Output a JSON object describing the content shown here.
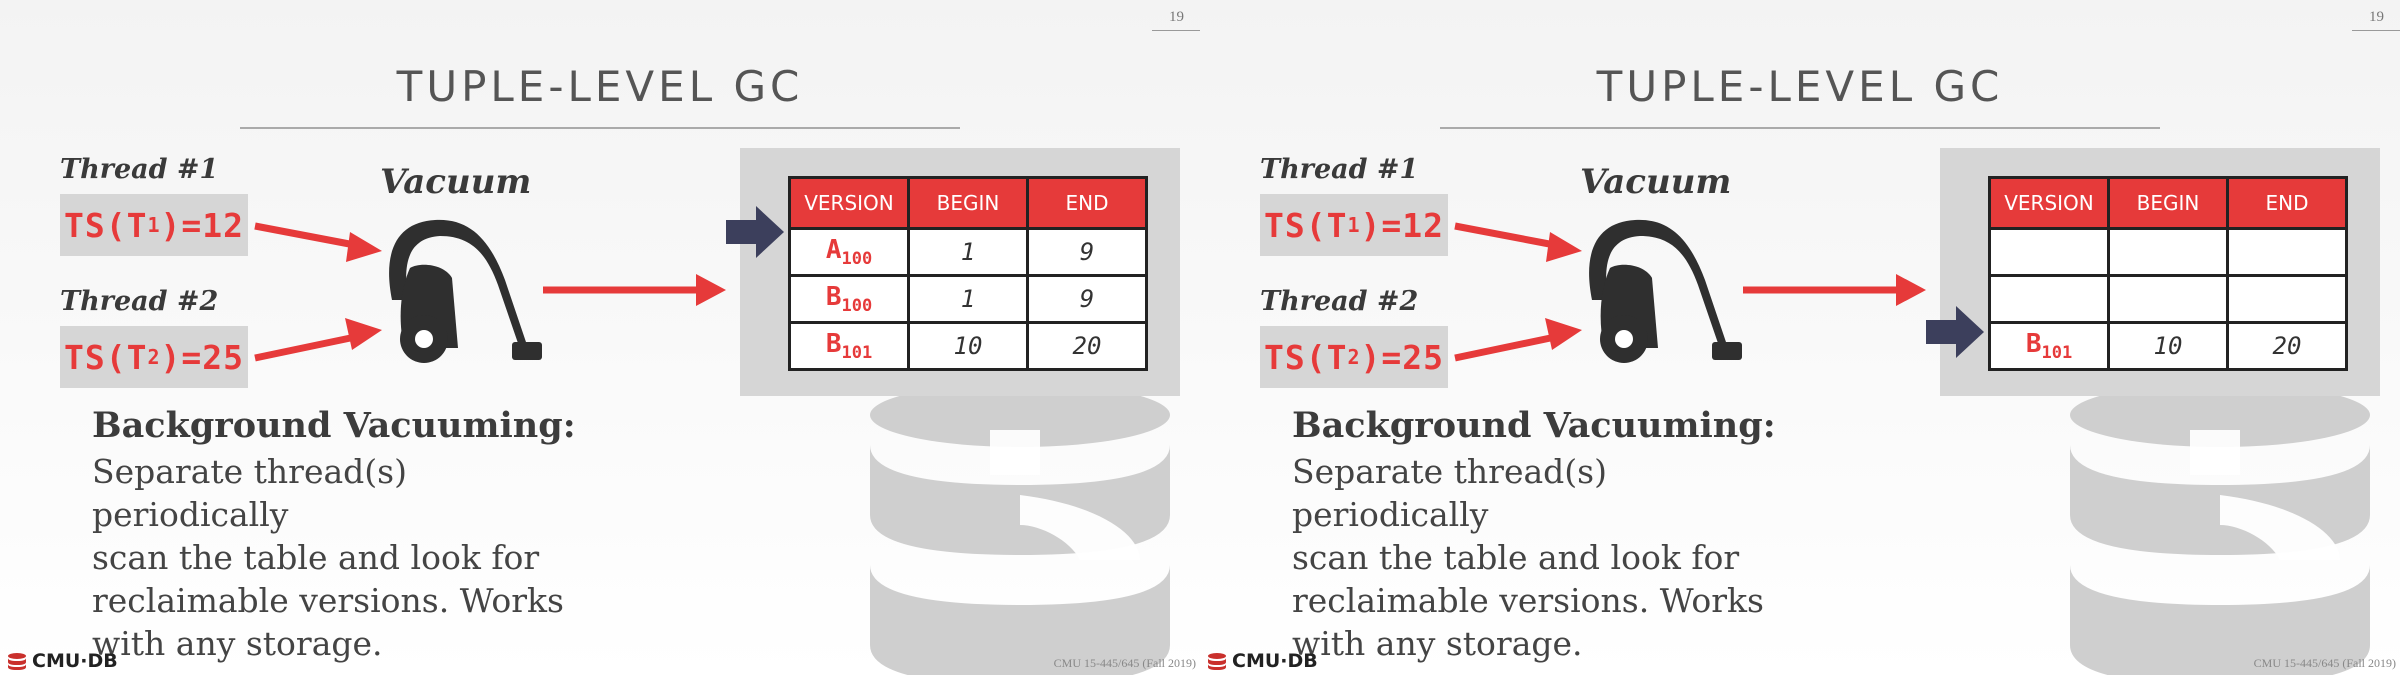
{
  "slides": [
    {
      "slide_number": "19",
      "title": "TUPLE-LEVEL GC",
      "thread1_label": "Thread #1",
      "thread2_label": "Thread #2",
      "ts1": {
        "prefix": "TS(T",
        "sub": "1",
        "suffix": ")=12"
      },
      "ts2": {
        "prefix": "TS(T",
        "sub": "2",
        "suffix": ")=25"
      },
      "vacuum_label": "Vacuum",
      "table": {
        "headers": [
          "VERSION",
          "BEGIN",
          "END"
        ],
        "rows": [
          {
            "ver": "A",
            "sub": "100",
            "begin": "1",
            "end": "9"
          },
          {
            "ver": "B",
            "sub": "100",
            "begin": "1",
            "end": "9"
          },
          {
            "ver": "B",
            "sub": "101",
            "begin": "10",
            "end": "20"
          }
        ]
      },
      "pointer_row": 0,
      "body_heading": "Background Vacuuming:",
      "body_lines": [
        "Separate thread(s) periodically",
        "scan the table and look for",
        "reclaimable versions. Works",
        "with any storage."
      ],
      "logo_text": "CMU·DB",
      "footer": "CMU 15-445/645 (Fall 2019)"
    },
    {
      "slide_number": "19",
      "title": "TUPLE-LEVEL GC",
      "thread1_label": "Thread #1",
      "thread2_label": "Thread #2",
      "ts1": {
        "prefix": "TS(T",
        "sub": "1",
        "suffix": ")=12"
      },
      "ts2": {
        "prefix": "TS(T",
        "sub": "2",
        "suffix": ")=25"
      },
      "vacuum_label": "Vacuum",
      "table": {
        "headers": [
          "VERSION",
          "BEGIN",
          "END"
        ],
        "rows": [
          {
            "ver": "",
            "sub": "",
            "begin": "",
            "end": ""
          },
          {
            "ver": "",
            "sub": "",
            "begin": "",
            "end": ""
          },
          {
            "ver": "B",
            "sub": "101",
            "begin": "10",
            "end": "20"
          }
        ]
      },
      "pointer_row": 2,
      "body_heading": "Background Vacuuming:",
      "body_lines": [
        "Separate thread(s) periodically",
        "scan the table and look for",
        "reclaimable versions. Works",
        "with any storage."
      ],
      "logo_text": "CMU·DB",
      "footer": "CMU 15-445/645 (Fall 2019)"
    }
  ],
  "colors": {
    "accent_red": "#e63a3a",
    "arrow_navy": "#3c3f5c",
    "panel_gray": "#d6d6d6",
    "icon_dark": "#2f2f2f"
  },
  "icons": {
    "vacuum": "vacuum-cleaner-icon",
    "pointer": "right-arrow-pointer-icon",
    "logo": "cmu-db-logo"
  }
}
